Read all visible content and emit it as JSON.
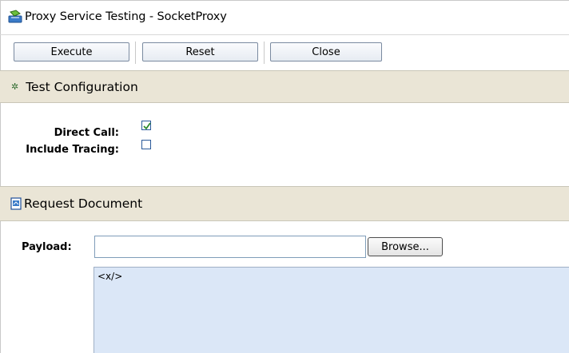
{
  "title": "Proxy Service Testing - SocketProxy",
  "toolbar": {
    "execute_label": "Execute",
    "reset_label": "Reset",
    "close_label": "Close"
  },
  "test_configuration": {
    "header": "Test Configuration",
    "direct_call_label": "Direct Call:",
    "direct_call_checked": true,
    "include_tracing_label": "Include Tracing:",
    "include_tracing_checked": false
  },
  "request_document": {
    "header": "Request Document",
    "payload_label": "Payload:",
    "payload_value": "",
    "browse_label": "Browse...",
    "document_text": "<x/>"
  },
  "icons": {
    "title": "proxy-service-icon",
    "test_config": "gear-icon",
    "request_doc": "document-icon"
  },
  "colors": {
    "section_header_bg": "#eae5d6",
    "textarea_bg": "#dbe7f7",
    "checkbox_border": "#2a5a9a",
    "checkmark": "#2e8b2e"
  }
}
